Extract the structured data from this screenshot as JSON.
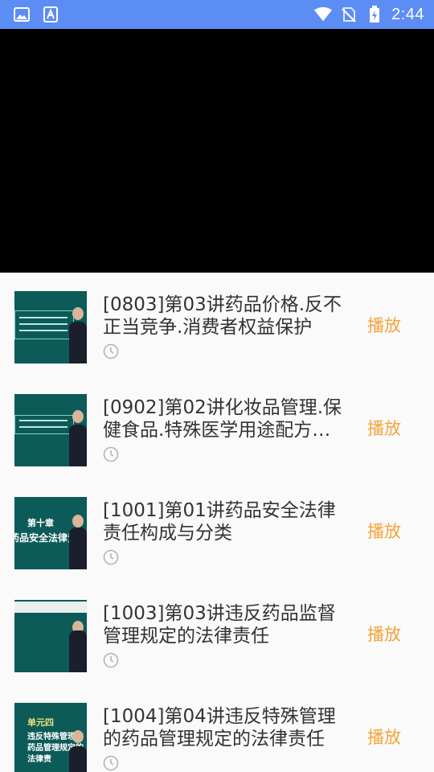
{
  "status_bar": {
    "time": "2:44",
    "left_icons": [
      "image-icon",
      "text-a-icon"
    ],
    "right_icons": [
      "wifi-icon",
      "no-sim-icon",
      "battery-charging-icon"
    ],
    "background": "#5c8df5"
  },
  "video_player": {
    "background": "#000000"
  },
  "courses": [
    {
      "title": "[0803]第03讲药品价格.反不正当竞争.消费者权益保护",
      "action": "播放"
    },
    {
      "title": "[0902]第02讲化妆品管理.保健食品.特殊医学用途配方…",
      "action": "播放"
    },
    {
      "title": "[1001]第01讲药品安全法律责任构成与分类",
      "action": "播放",
      "thumb_text_1": "第十章",
      "thumb_text_2": "药品安全法律责"
    },
    {
      "title": "[1003]第03讲违反药品监督管理规定的法律责任",
      "action": "播放"
    },
    {
      "title": "[1004]第04讲违反特殊管理的药品管理规定的法律责任",
      "action": "播放",
      "thumb_text_1": "单元四",
      "thumb_text_2": "违反特殊管理的药品管理规定的法律责"
    }
  ],
  "accent_color": "#f5a33a"
}
